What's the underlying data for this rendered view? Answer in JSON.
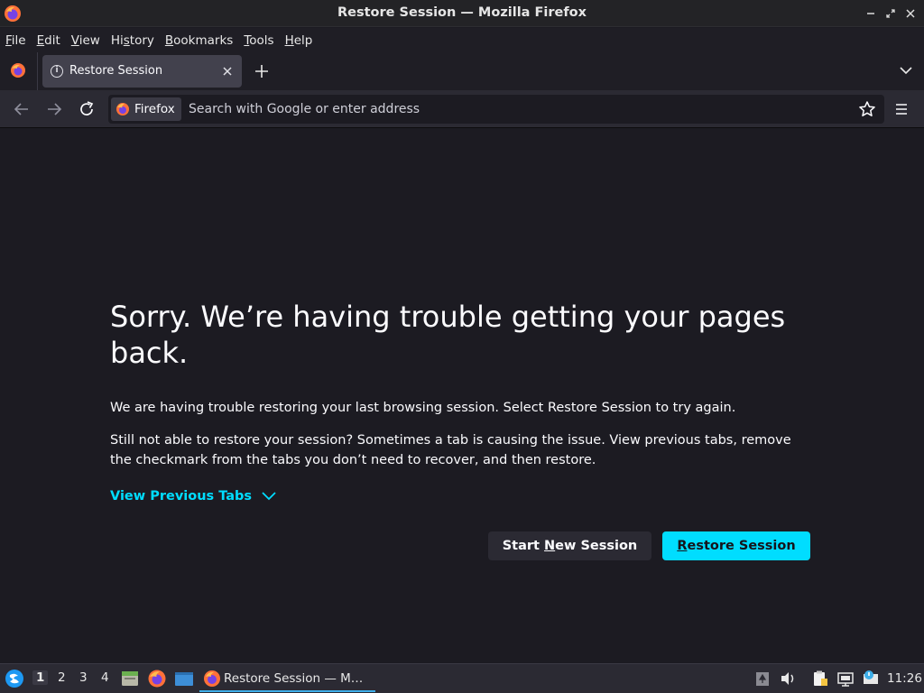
{
  "window": {
    "title": "Restore Session — Mozilla Firefox"
  },
  "menubar": {
    "items": [
      {
        "accel": "F",
        "rest": "ile"
      },
      {
        "accel": "E",
        "rest": "dit"
      },
      {
        "accel": "V",
        "rest": "iew"
      },
      {
        "pre": "Hi",
        "accel": "s",
        "rest": "tory"
      },
      {
        "accel": "B",
        "rest": "ookmarks"
      },
      {
        "accel": "T",
        "rest": "ools"
      },
      {
        "accel": "H",
        "rest": "elp"
      }
    ]
  },
  "tabs": {
    "active_label": "Restore Session"
  },
  "navbar": {
    "identity_label": "Firefox",
    "url_placeholder": "Search with Google or enter address",
    "url_value": ""
  },
  "page": {
    "heading": "Sorry. We’re having trouble getting your pages back.",
    "para1": "We are having trouble restoring your last browsing session. Select Restore Session to try again.",
    "para2": "Still not able to restore your session? Sometimes a tab is causing the issue. View previous tabs, remove the checkmark from the tabs you don’t need to recover, and then restore.",
    "view_tabs_label": "View Previous Tabs",
    "start_new_pre": "Start ",
    "start_new_accel": "N",
    "start_new_post": "ew Session",
    "restore_accel": "R",
    "restore_post": "estore Session"
  },
  "taskbar": {
    "workspaces": [
      "1",
      "2",
      "3",
      "4"
    ],
    "active_workspace": "1",
    "task_label": "Restore Session — M…",
    "clock": "11:26"
  },
  "colors": {
    "accent": "#00ddff",
    "background": "#1c1b22",
    "toolbar": "#2b2a33"
  }
}
